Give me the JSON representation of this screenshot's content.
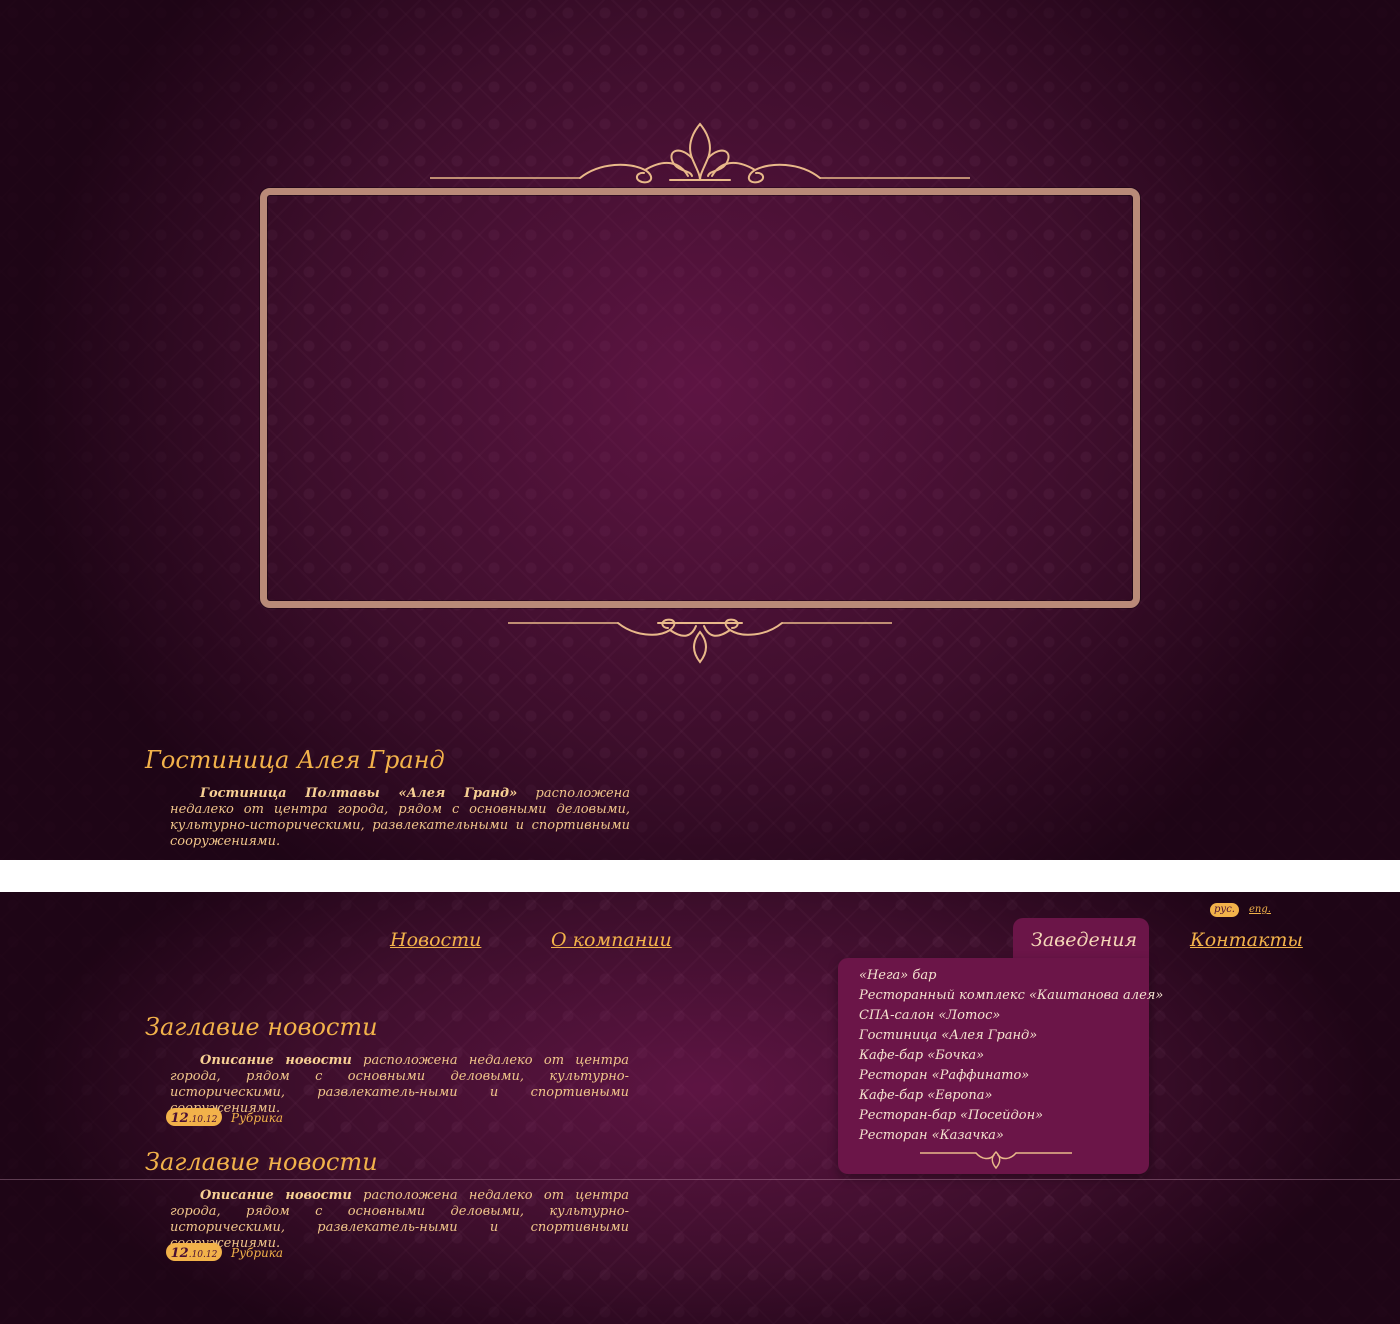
{
  "colors": {
    "accent": "#f2b24a",
    "menu_bg": "#6b1548",
    "frame": "#b98a78",
    "background": "#3d0f2c"
  },
  "hero": {
    "title": "Гостиница Алея Гранд",
    "text_bold": "Гостиница Полтавы «Алея Гранд»",
    "text_rest": " расположена недалеко от центра города, рядом с основными деловыми, культурно-историческими, развлекательными и спортивными сооружениями."
  },
  "lang": {
    "active": "рус.",
    "other": "eng."
  },
  "nav": {
    "news": "Новости",
    "company": "О компании",
    "venues": "Заведения",
    "contacts": "Контакты"
  },
  "venues_menu": [
    "«Нега» бар",
    "Ресторанный комплекс «Каштанова алея»",
    "СПА-салон «Лотос»",
    "Гостиница «Алея Гранд»",
    "Кафе-бар «Бочка»",
    "Ресторан «Раффинато»",
    "Кафе-бар «Европа»",
    "Ресторан-бар «Посейдон»",
    "Ресторан «Казачка»"
  ],
  "news": [
    {
      "title": "Заглавие новости",
      "text_bold": "Описание новости",
      "text_rest": "  расположена недалеко от центра города, рядом с основными деловыми, культурно-историческими, развлекатель-ными и спортивными сооружениями.",
      "date_day": "12",
      "date_rest": ".10.12",
      "rubric": "Рубрика"
    },
    {
      "title": "Заглавие новости",
      "text_bold": "Описание новости",
      "text_rest": "  расположена недалеко от центра города, рядом с основными деловыми, культурно-историческими, развлекатель-ными и спортивными сооружениями.",
      "date_day": "12",
      "date_rest": ".10.12",
      "rubric": "Рубрика"
    }
  ],
  "icons": [
    "ornament-top-icon",
    "ornament-bottom-icon",
    "ornament-small-icon"
  ]
}
